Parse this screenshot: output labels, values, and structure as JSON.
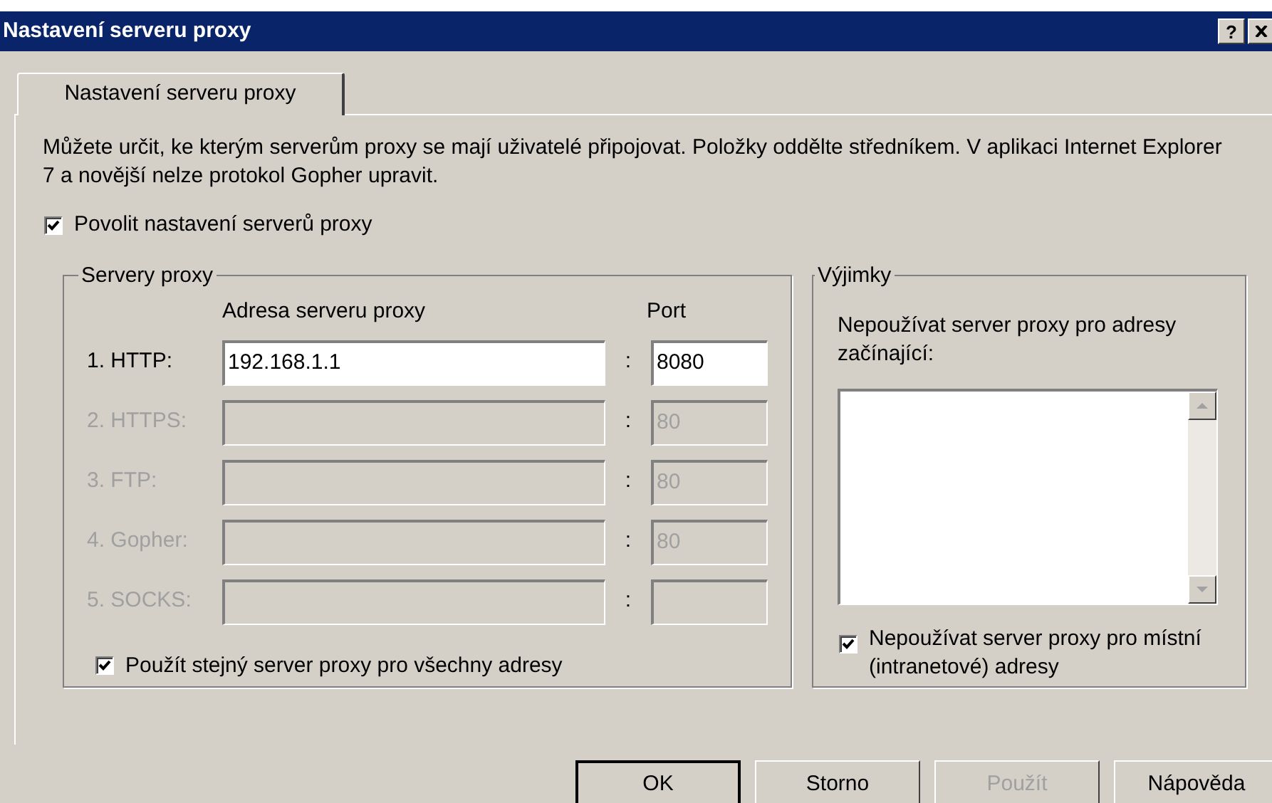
{
  "window": {
    "title": "Nastavení serveru proxy",
    "help_button": "?"
  },
  "tabs": [
    {
      "label": "Nastavení serveru proxy",
      "selected": true
    }
  ],
  "description": "Můžete určit, ke kterým serverům proxy se mají uživatelé připojovat. Položky oddělte středníkem. V aplikaci Internet Explorer 7 a novější nelze protokol Gopher upravit.",
  "enable_proxy": {
    "label": "Povolit nastavení serverů proxy",
    "checked": true
  },
  "servers": {
    "title": "Servery proxy",
    "address_header": "Adresa serveru proxy",
    "port_header": "Port",
    "rows": [
      {
        "label": "1. HTTP:",
        "address": "192.168.1.1",
        "separator": ":",
        "port": "8080",
        "disabled": false
      },
      {
        "label": "2. HTTPS:",
        "separator": ":",
        "port": "80",
        "disabled": true
      },
      {
        "label": "3. FTP:",
        "separator": ":",
        "port": "80",
        "disabled": true
      },
      {
        "label": "4. Gopher:",
        "separator": ":",
        "port": "80",
        "disabled": true
      },
      {
        "label": "5. SOCKS:",
        "separator": ":",
        "disabled": true
      }
    ],
    "same_proxy": {
      "label": "Použít stejný server proxy pro všechny adresy",
      "checked": true
    }
  },
  "exceptions": {
    "title": "Výjimky",
    "prompt": "Nepoužívat server proxy pro adresy začínající:",
    "bypass_local": {
      "label": "Nepoužívat server proxy pro místní (intranetové) adresy",
      "checked": true
    }
  },
  "buttons": [
    {
      "label": "OK",
      "default": true,
      "disabled": false
    },
    {
      "label": "Storno",
      "default": false,
      "disabled": false
    },
    {
      "label": "Použít",
      "default": false,
      "disabled": true
    },
    {
      "label": "Nápověda",
      "default": false,
      "disabled": false
    }
  ]
}
